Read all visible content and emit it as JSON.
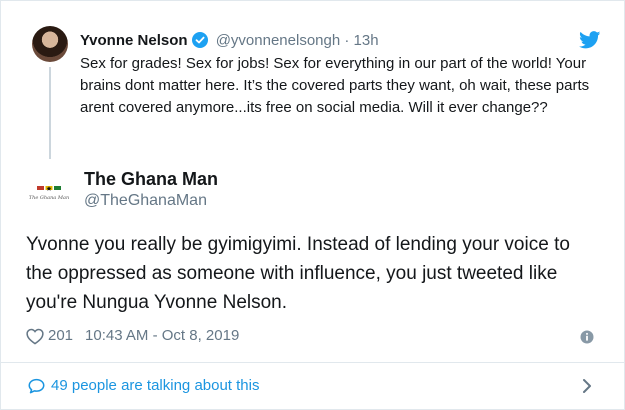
{
  "parent": {
    "name": "Yvonne Nelson",
    "handle": "@yvonnenelsongh",
    "dot": "·",
    "time": "13h",
    "text": "Sex for grades! Sex for jobs! Sex for everything in our part of the world! Your brains dont matter here. It’s the covered  parts they want, oh wait, these parts arent covered anymore...its free on social media. Will it ever change??",
    "verified_icon": "verified-badge-icon"
  },
  "main": {
    "avatar_text": "The Ghana Man",
    "name": "The Ghana Man",
    "handle": "@TheGhanaMan",
    "text": "Yvonne you really be gyimigyimi. Instead of lending your voice to the oppressed as someone with influence, you just tweeted like you're Nungua Yvonne Nelson.",
    "likes": "201",
    "timestamp": "10:43 AM - Oct 8, 2019"
  },
  "footer": {
    "talking": "49 people are talking about this"
  },
  "colors": {
    "accent": "#1da1f2",
    "link": "#1b95e0",
    "muted": "#657786",
    "border": "#e1e8ed"
  },
  "icons": [
    "twitter-bird-icon",
    "heart-icon",
    "info-icon",
    "speech-bubble-icon",
    "chevron-right-icon"
  ]
}
